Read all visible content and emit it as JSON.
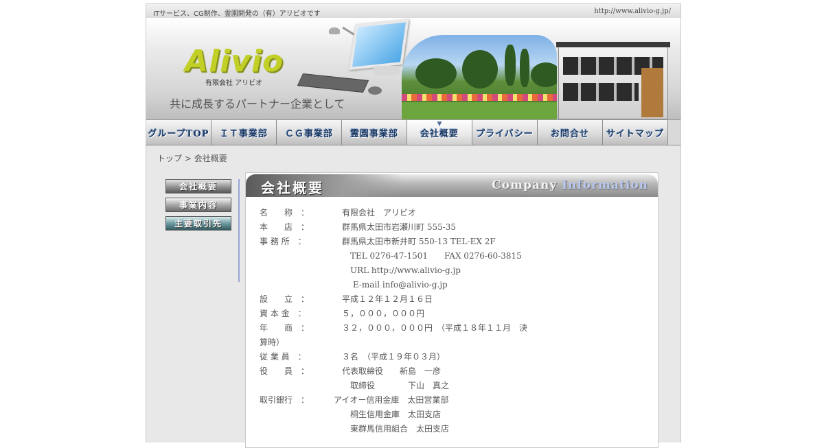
{
  "topbar": {
    "tagline": "ITサービス、CG制作、霊園開発の（有）アリビオです",
    "url": "http://www.alivio-g.jp/"
  },
  "banner": {
    "logo": "Alivio",
    "company": "有限会社 アリビオ",
    "slogan": "共に成長するパートナー企業として"
  },
  "nav": {
    "items": [
      {
        "label": "グループTOP"
      },
      {
        "label": "ＩＴ事業部"
      },
      {
        "label": "ＣＧ事業部"
      },
      {
        "label": "霊園事業部"
      },
      {
        "label": "会社概要",
        "active": true
      },
      {
        "label": "プライバシー"
      },
      {
        "label": "お問合せ"
      },
      {
        "label": "サイトマップ"
      }
    ]
  },
  "breadcrumb": {
    "home": "トップ",
    "separator": " > ",
    "current": "会社概要"
  },
  "sidemenu": {
    "items": [
      {
        "label": "会社概要"
      },
      {
        "label": "事業内容"
      },
      {
        "label": "主要取引先"
      }
    ]
  },
  "content": {
    "title": "会社概要",
    "title_en_a": "Company ",
    "title_en_b": "Information",
    "rows": [
      {
        "label": "名　　称　：",
        "value": "　有限会社　アリビオ"
      },
      {
        "label": "本　　店　：",
        "value": "　群馬県太田市岩瀬川町 555-35"
      },
      {
        "label": "事 務 所　：",
        "value": "　群馬県太田市新井町 550-13 TEL-EX 2F"
      },
      {
        "cont": "TEL 0276-47-1501　　FAX 0276-60-3815"
      },
      {
        "cont": "URL http://www.alivio-g.jp"
      },
      {
        "cont": " E-mail info@alivio-g.jp"
      },
      {
        "label": "設　　立　：",
        "value": "　平成１２年１２月１６日"
      },
      {
        "label": "資 本 金　：",
        "value": "　５，０００，０００円"
      },
      {
        "label": "年　　商　：",
        "value": "　３２，０００，０００円　（平成１８年１１月　決"
      },
      {
        "wrap": "算時）"
      },
      {
        "label": "従 業 員　：",
        "value": "　３名　（平成１９年０３月）"
      },
      {
        "label": "役　　員　：",
        "value": "　代表取締役　　新島　一彦"
      },
      {
        "cont": "取締役　　　　下山　真之"
      },
      {
        "label": "取引銀行　：",
        "value": "アイオー信用金庫　太田営業部"
      },
      {
        "cont": "桐生信用金庫　太田支店"
      },
      {
        "cont": "東群馬信用組合　太田支店"
      }
    ]
  }
}
